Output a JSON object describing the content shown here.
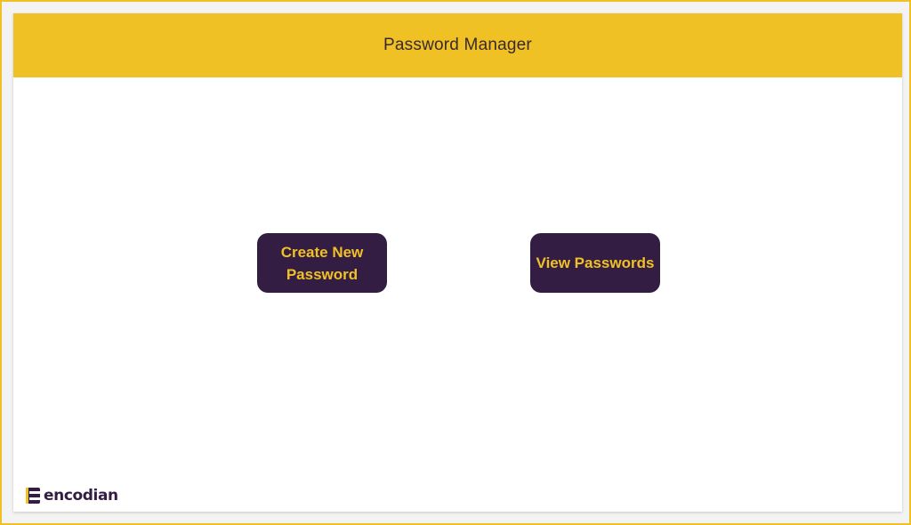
{
  "header": {
    "title": "Password Manager"
  },
  "actions": {
    "create_label": "Create New Password",
    "view_label": "View Passwords"
  },
  "branding": {
    "name": "encodian",
    "logo_icon": "encodian-logo-icon"
  },
  "colors": {
    "accent": "#f0c124",
    "button_background": "#331d43",
    "button_text": "#f0c124"
  }
}
